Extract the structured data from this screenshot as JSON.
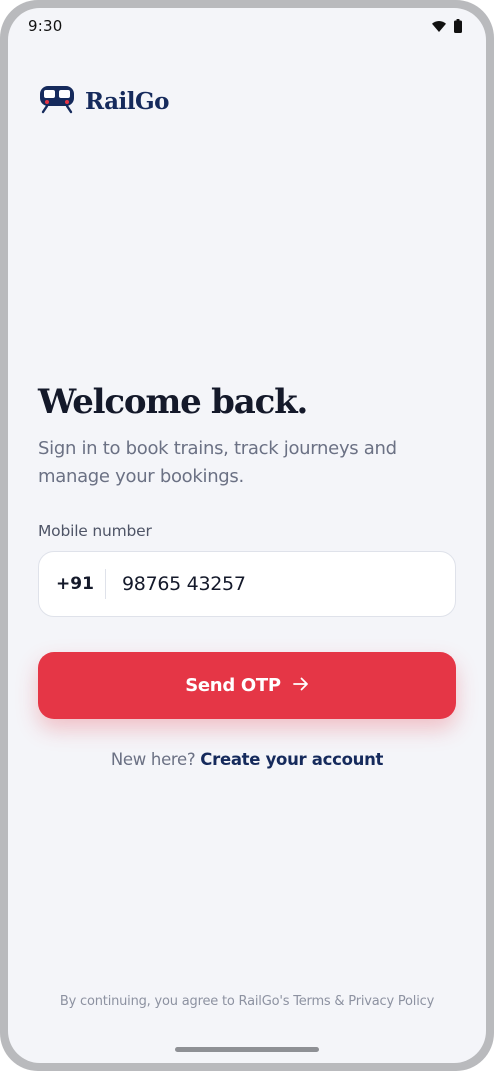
{
  "status_bar": {
    "time": "9:30",
    "icons": [
      "wifi-icon",
      "battery-icon"
    ]
  },
  "brand": {
    "name": "RailGo",
    "logo_icon": "train-icon",
    "color": "#152a5c"
  },
  "login": {
    "title": "Welcome back.",
    "subtitle": "Sign in to book trains, track journeys and manage your bookings.",
    "mobile_label": "Mobile number",
    "country_code": "+91",
    "mobile_value": "98765 43257",
    "send_button_label": "Send OTP",
    "send_button_icon": "arrow-right-icon",
    "accent_color": "#e53646"
  },
  "signup": {
    "prompt": "New here? ",
    "link_label": "Create your account"
  },
  "footer": {
    "legal_text": "By continuing, you agree to RailGo's Terms & Privacy Policy"
  }
}
